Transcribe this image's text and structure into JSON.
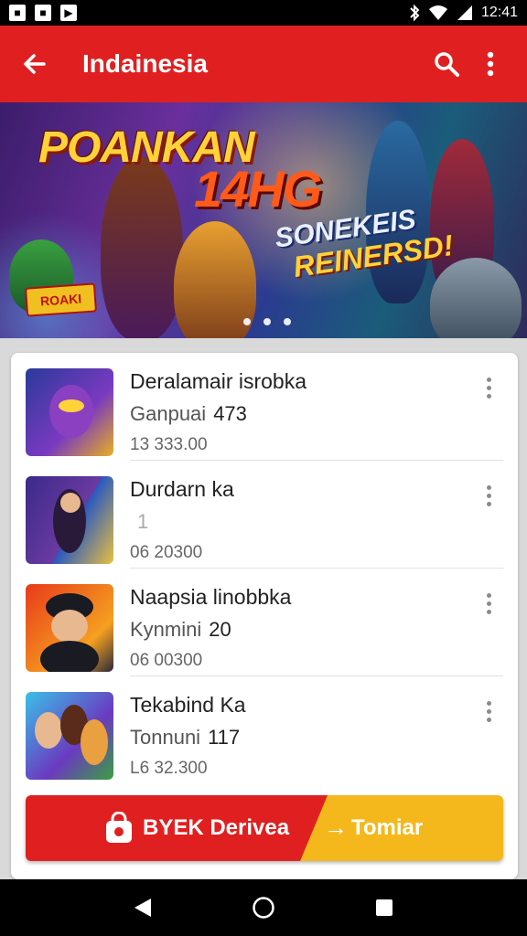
{
  "status_bar": {
    "time": "12:41",
    "left_icons": [
      "app-icon-1",
      "app-icon-2",
      "app-icon-3"
    ],
    "right_icons": [
      "bluetooth-icon",
      "wifi-icon",
      "signal-icon"
    ]
  },
  "app_bar": {
    "title": "Indainesia",
    "back_icon": "arrow-left-icon",
    "search_icon": "search-icon",
    "menu_icon": "more-vert-icon",
    "color": "#e02020"
  },
  "banner": {
    "headline_1": "POANKAN",
    "headline_2": "14HG",
    "tagline_1": "SONEKEIS",
    "tagline_2": "REINERSD!",
    "badge": "ROAKI",
    "page_count": 3,
    "current_page": 1
  },
  "list": {
    "items": [
      {
        "name": "Deralamair isrobka",
        "subtitle": "Ganpuai",
        "count": "473",
        "meta": "13 333.00"
      },
      {
        "name": "Durdarn ka",
        "subtitle": "",
        "count": "1",
        "meta": "06 20300"
      },
      {
        "name": "Naapsia linobbka",
        "subtitle": "Kynmini",
        "count": "20",
        "meta": "06 00300"
      },
      {
        "name": "Tekabind Ka",
        "subtitle": "Tonnuni",
        "count": "117",
        "meta": "L6 32.300"
      }
    ]
  },
  "cta": {
    "primary_label": "BYEK Derivea",
    "arrow": "→",
    "secondary_label": "Tomiar",
    "primary_color": "#e02020",
    "secondary_color": "#f5b81c",
    "icon": "shopping-bag-icon"
  },
  "nav_bar": {
    "back_icon": "triangle-back-icon",
    "home_icon": "circle-home-icon",
    "recents_icon": "square-recents-icon"
  }
}
